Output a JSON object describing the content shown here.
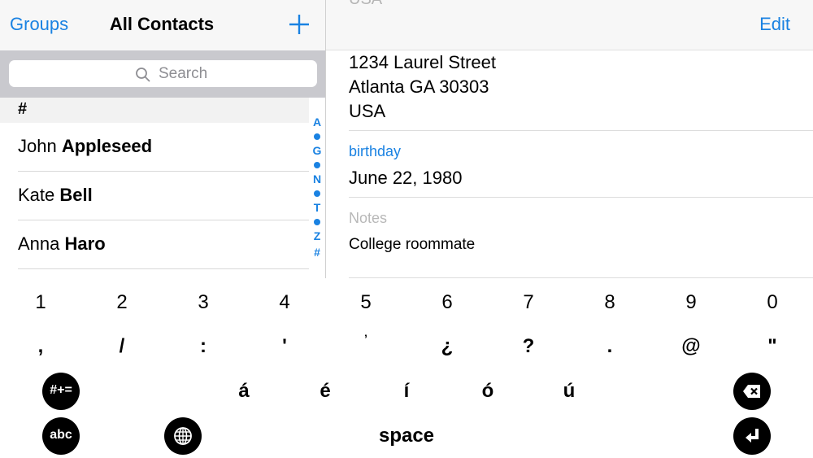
{
  "left_nav": {
    "groups_label": "Groups",
    "title": "All Contacts"
  },
  "search": {
    "placeholder": "Search"
  },
  "section": {
    "header": "#"
  },
  "contacts": [
    {
      "first": "John",
      "last": "Appleseed"
    },
    {
      "first": "Kate",
      "last": "Bell"
    },
    {
      "first": "Anna",
      "last": "Haro"
    }
  ],
  "index_letters": [
    "A",
    "G",
    "N",
    "T",
    "Z",
    "#"
  ],
  "right_nav": {
    "edit_label": "Edit",
    "cut_top_label": "USA"
  },
  "address": {
    "line1": "1234 Laurel Street",
    "line2": "Atlanta GA 30303",
    "line3": "USA"
  },
  "birthday": {
    "label": "birthday",
    "value": "June 22, 1980"
  },
  "notes": {
    "label": "Notes",
    "value": "College roommate"
  },
  "keyboard": {
    "row1": [
      "1",
      "2",
      "3",
      "4",
      "5",
      "6",
      "7",
      "8",
      "9",
      "0"
    ],
    "row2": [
      ",",
      "/",
      ":",
      "'",
      "’",
      "¿",
      "?",
      ".",
      "@",
      "\""
    ],
    "accents": [
      "á",
      "é",
      "í",
      "ó",
      "ú"
    ],
    "symbols_key": "#+=",
    "abc_key": "abc",
    "space_label": "space"
  },
  "colors": {
    "accent": "#1a82e2",
    "search_bar_bg": "#c9c9ce",
    "keyboard_key_bg": "#000000"
  }
}
